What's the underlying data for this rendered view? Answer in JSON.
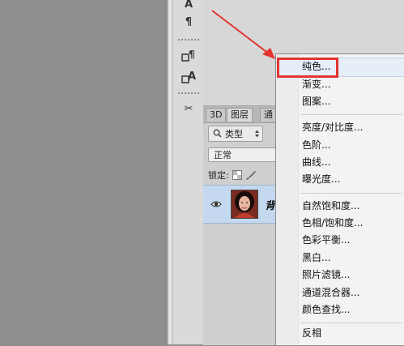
{
  "canvas": {},
  "tools": {
    "items": [
      {
        "name": "character-panel-icon",
        "glyph": "A"
      },
      {
        "name": "paragraph-panel-icon",
        "glyph": "¶"
      },
      {
        "name": "paragraph-style-icon",
        "glyph": "¶"
      },
      {
        "name": "character-style-icon",
        "glyph": "A"
      },
      {
        "name": "scissors-icon",
        "glyph": "✂"
      }
    ]
  },
  "layers_panel": {
    "tabs": [
      "3D",
      "图层",
      "通"
    ],
    "filter_label": "类型",
    "blend_mode": "正常",
    "lock_label": "锁定:",
    "layer_name": "背"
  },
  "menu": {
    "items": [
      "纯色...",
      "渐变...",
      "图案...",
      "亮度/对比度...",
      "色阶...",
      "曲线...",
      "曝光度...",
      "自然饱和度...",
      "色相/饱和度...",
      "色彩平衡...",
      "黑白...",
      "照片滤镜...",
      "通道混合器...",
      "颜色查找...",
      "反相"
    ]
  },
  "annotation": {
    "highlight_color": "#e3342f"
  }
}
